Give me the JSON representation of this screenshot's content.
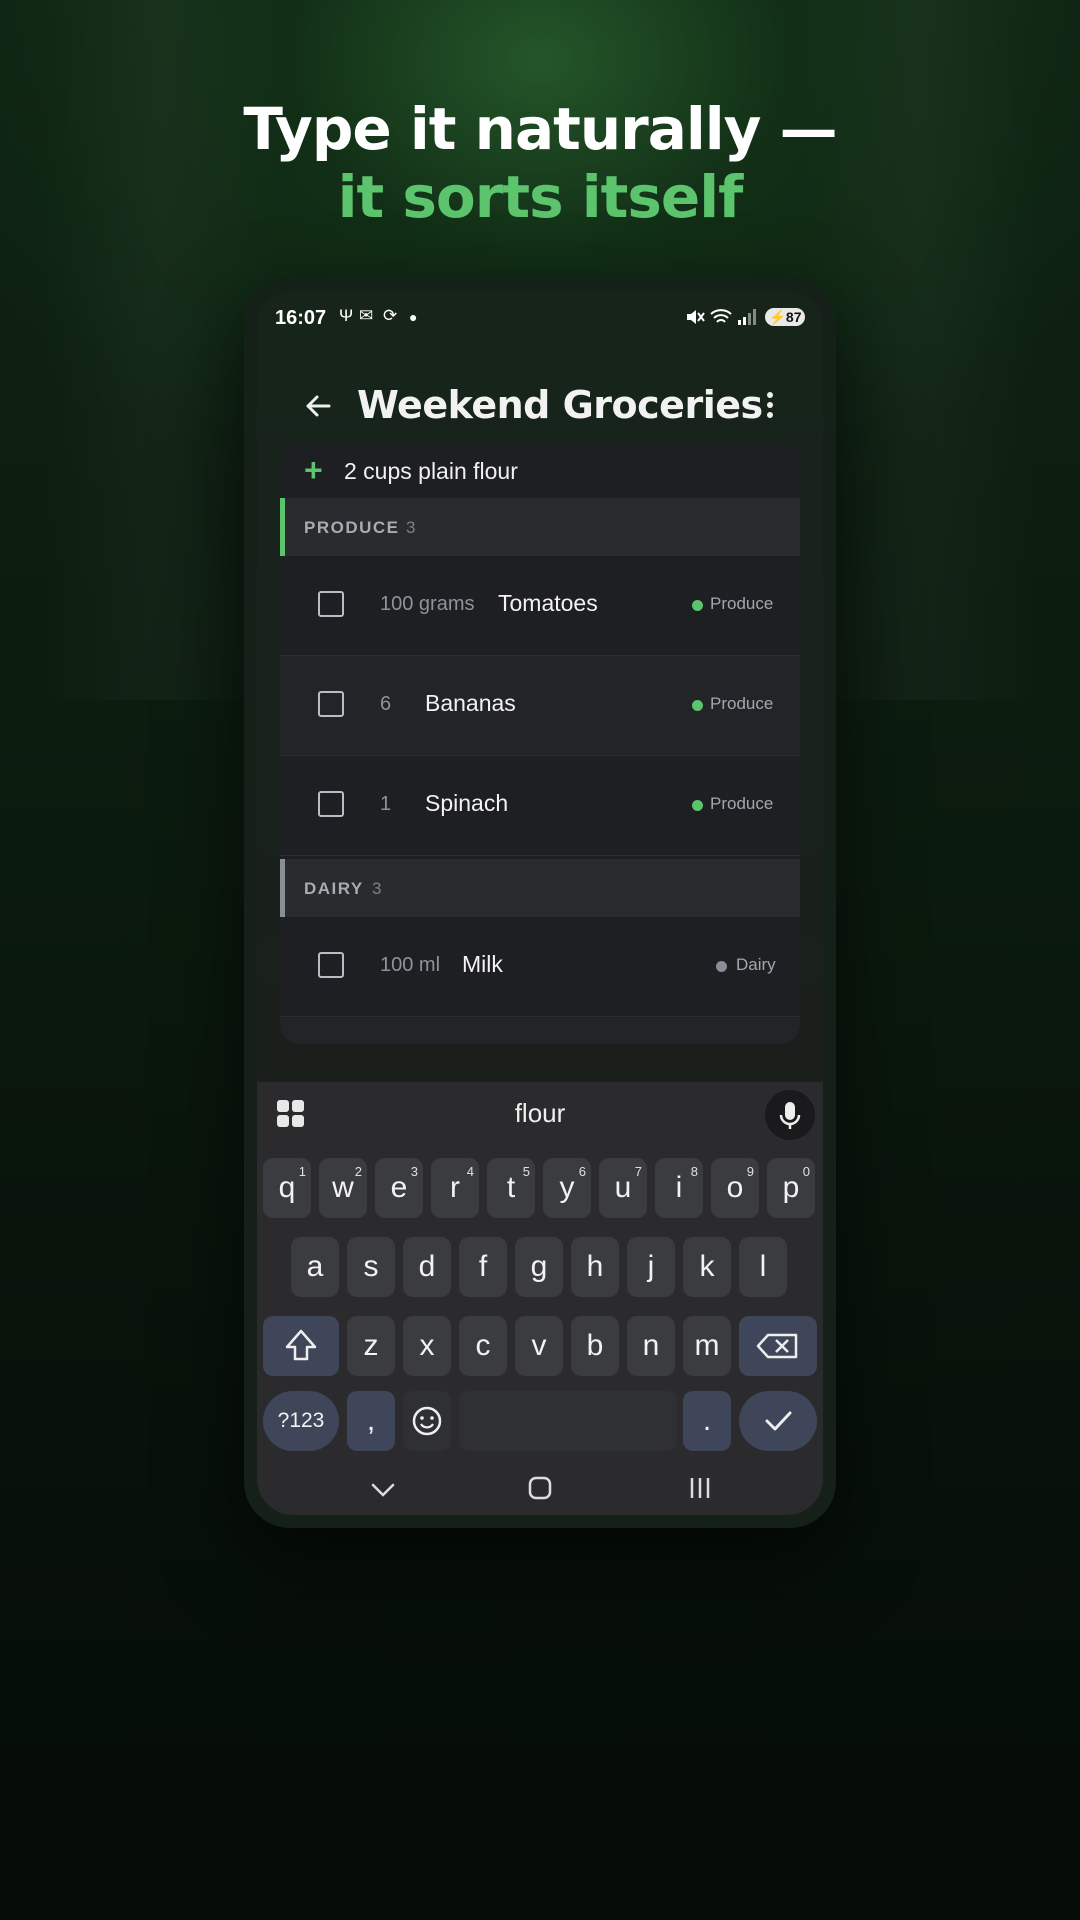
{
  "headline": {
    "line1": "Type it naturally —",
    "line2": "it sorts itself"
  },
  "status_bar": {
    "time": "16:07",
    "battery": "87"
  },
  "app_bar": {
    "title": "Weekend Groceries"
  },
  "add_item": {
    "value": "2 cups plain flour"
  },
  "sections": [
    {
      "name": "PRODUCE",
      "count": "3",
      "color": "#5cc46c",
      "items": [
        {
          "qty": "100 grams",
          "name": "Tomatoes",
          "tag": "Produce"
        },
        {
          "qty": "6",
          "name": "Bananas",
          "tag": "Produce"
        },
        {
          "qty": "1",
          "name": "Spinach",
          "tag": "Produce"
        }
      ]
    },
    {
      "name": "DAIRY",
      "count": "3",
      "color": "#8a8f97",
      "items": [
        {
          "qty": "100 ml",
          "name": "Milk",
          "tag": "Dairy"
        }
      ]
    }
  ],
  "keyboard": {
    "suggestion": "flour",
    "row1": [
      {
        "k": "q",
        "n": "1"
      },
      {
        "k": "w",
        "n": "2"
      },
      {
        "k": "e",
        "n": "3"
      },
      {
        "k": "r",
        "n": "4"
      },
      {
        "k": "t",
        "n": "5"
      },
      {
        "k": "y",
        "n": "6"
      },
      {
        "k": "u",
        "n": "7"
      },
      {
        "k": "i",
        "n": "8"
      },
      {
        "k": "o",
        "n": "9"
      },
      {
        "k": "p",
        "n": "0"
      }
    ],
    "row2": [
      "a",
      "s",
      "d",
      "f",
      "g",
      "h",
      "j",
      "k",
      "l"
    ],
    "row3": [
      "z",
      "x",
      "c",
      "v",
      "b",
      "n",
      "m"
    ],
    "symbols_label": "?123",
    "comma": ",",
    "period": "."
  },
  "colors": {
    "accent": "#5cc46c",
    "card": "#1e1f22",
    "modifier_key": "#3f4659"
  }
}
